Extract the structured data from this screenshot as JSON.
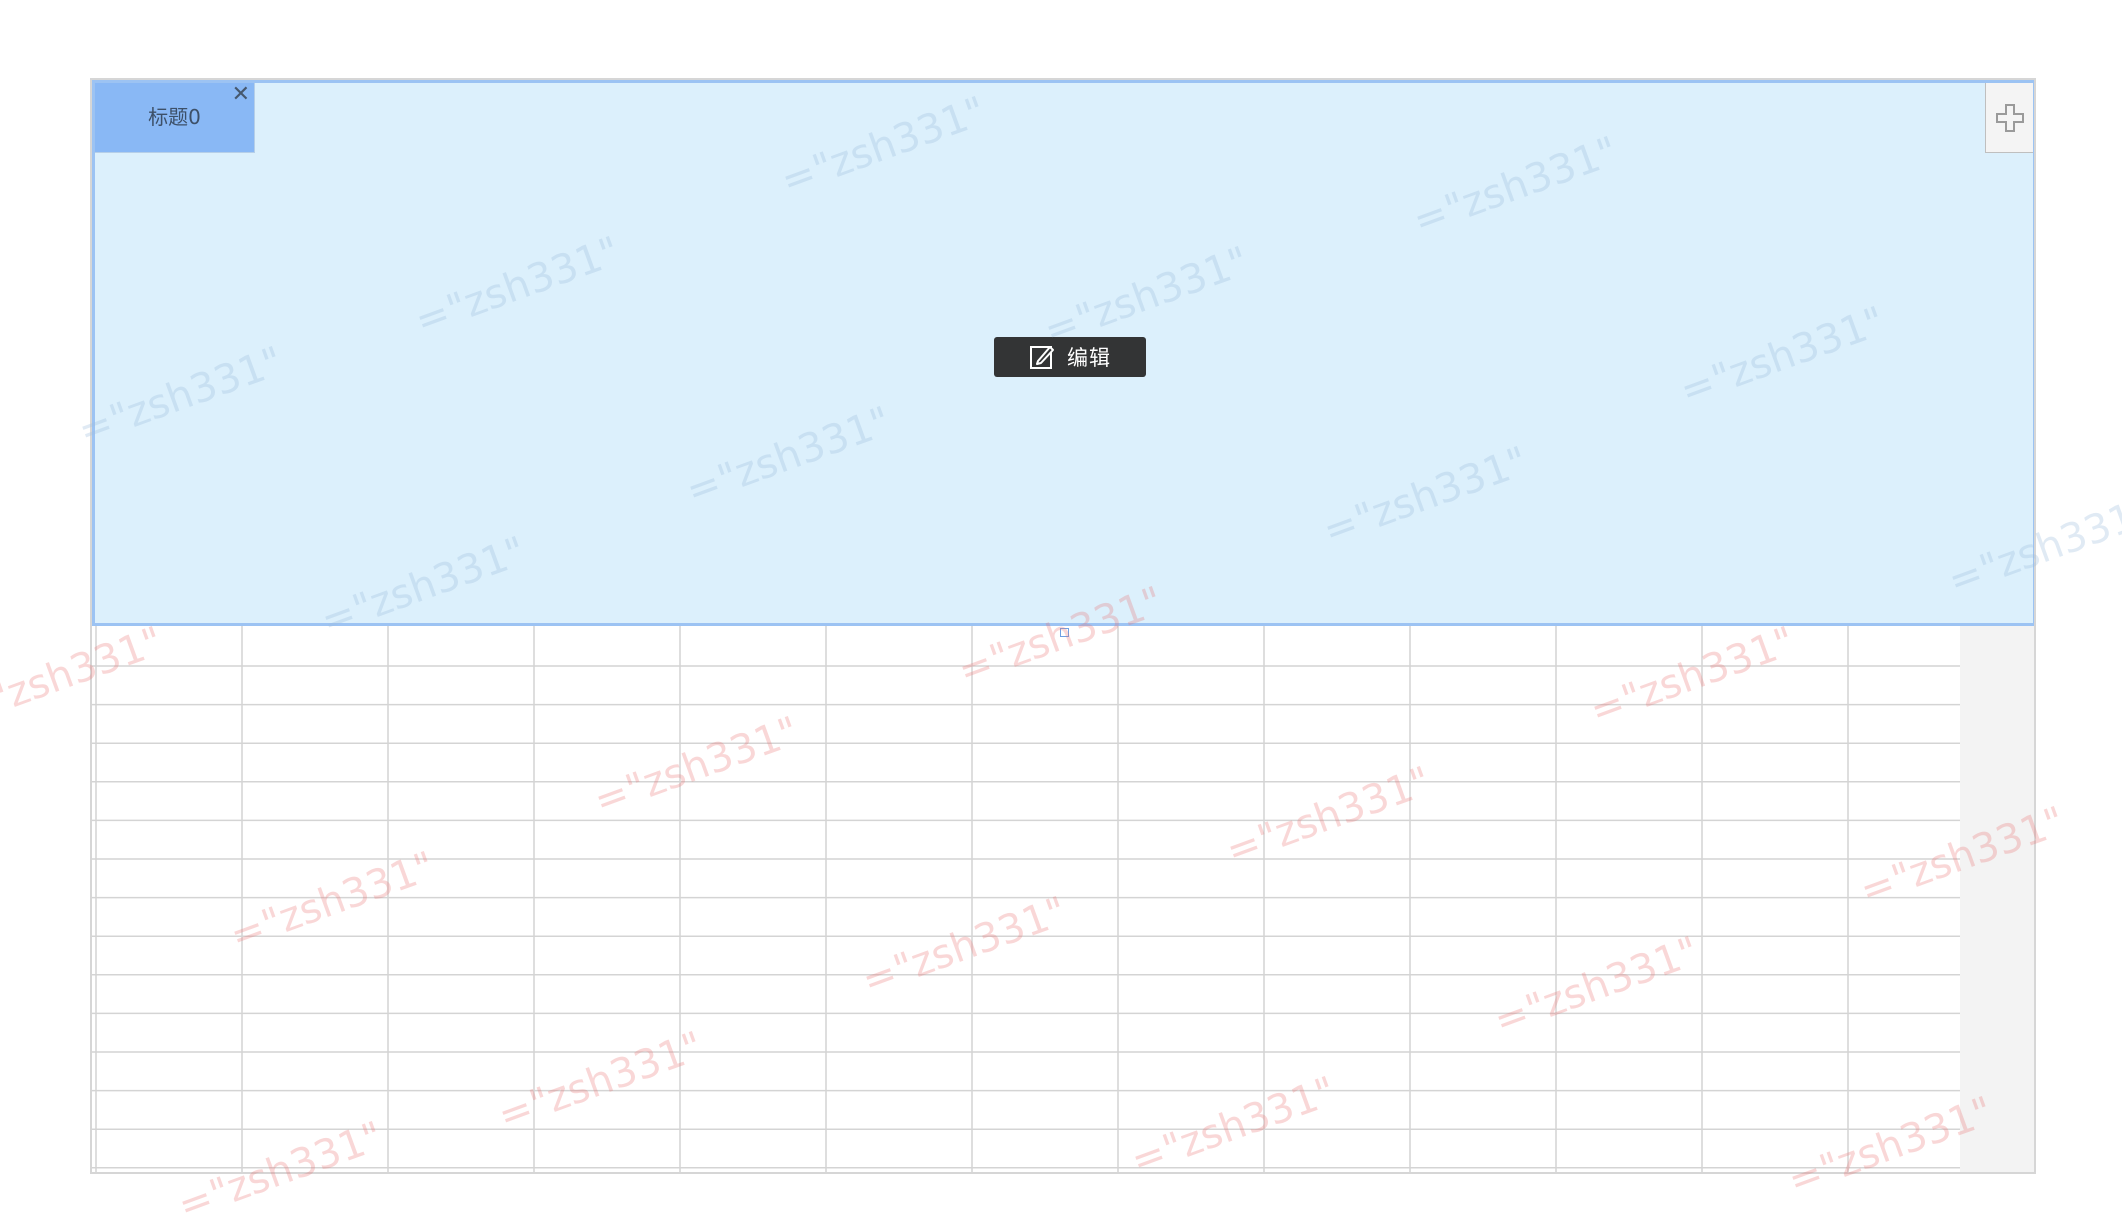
{
  "tab": {
    "title": "标题0",
    "close_glyph": "✕"
  },
  "toolbar": {
    "edit_label": "编辑",
    "edit_icon": "edit-icon",
    "add_icon": "plus-icon"
  },
  "watermark": {
    "text": "=\"zsh331\""
  },
  "grid": {
    "rows": 14,
    "columns": 13
  },
  "colors": {
    "panel_background": "#dcf0fc",
    "panel_border": "#9cc3f3",
    "tab_background": "#89b8f5",
    "edit_button_background": "#333435",
    "grid_line": "#d4d4d4"
  }
}
